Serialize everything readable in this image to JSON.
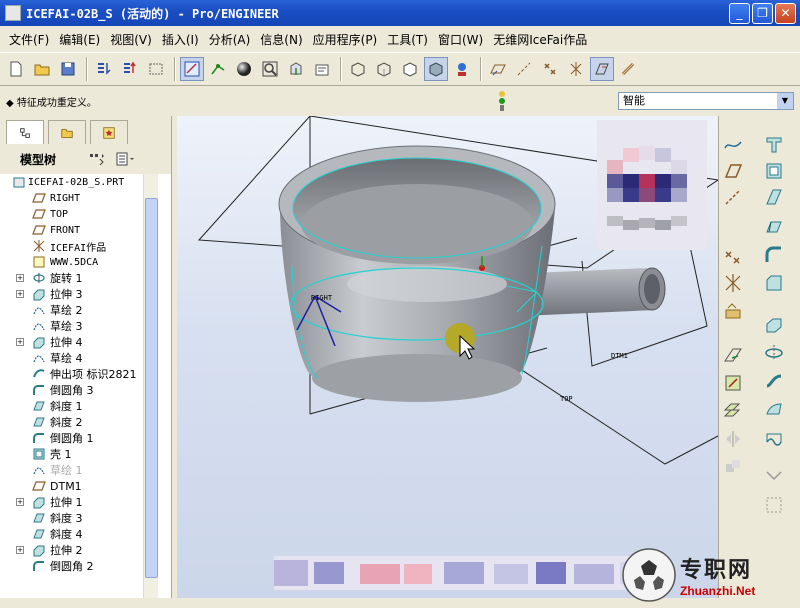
{
  "window": {
    "title": "ICEFAI-02B_S (活动的) - Pro/ENGINEER",
    "min_label": "_",
    "max_label": "❐",
    "close_label": "✕"
  },
  "menu": [
    {
      "label": "文件(F)"
    },
    {
      "label": "编辑(E)"
    },
    {
      "label": "视图(V)"
    },
    {
      "label": "插入(I)"
    },
    {
      "label": "分析(A)"
    },
    {
      "label": "信息(N)"
    },
    {
      "label": "应用程序(P)"
    },
    {
      "label": "工具(T)"
    },
    {
      "label": "窗口(W)"
    },
    {
      "label": "无维网IceFai作品"
    }
  ],
  "status": {
    "message": "◆ 特征成功重定义。",
    "filter_value": "智能"
  },
  "model_tree": {
    "header": "模型树",
    "items": [
      {
        "label": "ICEFAI-02B_S.PRT",
        "expand": "",
        "icon": "part-icon"
      },
      {
        "label": "RIGHT",
        "expand": "",
        "icon": "datum-plane-icon"
      },
      {
        "label": "TOP",
        "expand": "",
        "icon": "datum-plane-icon"
      },
      {
        "label": "FRONT",
        "expand": "",
        "icon": "datum-plane-icon"
      },
      {
        "label": "ICEFAI作品",
        "expand": "",
        "icon": "csys-icon"
      },
      {
        "label": "WWW.5DCA",
        "expand": "",
        "icon": "note-icon"
      },
      {
        "label": "旋转 1",
        "expand": "+",
        "icon": "revolve-icon"
      },
      {
        "label": "拉伸 3",
        "expand": "+",
        "icon": "extrude-icon"
      },
      {
        "label": "草绘 2",
        "expand": "",
        "icon": "sketch-icon"
      },
      {
        "label": "草绘 3",
        "expand": "",
        "icon": "sketch-icon"
      },
      {
        "label": "拉伸 4",
        "expand": "+",
        "icon": "extrude-icon"
      },
      {
        "label": "草绘 4",
        "expand": "",
        "icon": "sketch-icon"
      },
      {
        "label": "伸出项 标识2821",
        "expand": "",
        "icon": "protrusion-icon"
      },
      {
        "label": "倒圆角 3",
        "expand": "",
        "icon": "round-icon"
      },
      {
        "label": "斜度 1",
        "expand": "",
        "icon": "draft-icon"
      },
      {
        "label": "斜度 2",
        "expand": "",
        "icon": "draft-icon"
      },
      {
        "label": "倒圆角 1",
        "expand": "",
        "icon": "round-icon"
      },
      {
        "label": "壳 1",
        "expand": "",
        "icon": "shell-icon"
      },
      {
        "label": "草绘 1",
        "expand": "",
        "icon": "sketch-icon",
        "dim": true
      },
      {
        "label": "DTM1",
        "expand": "",
        "icon": "datum-plane-icon"
      },
      {
        "label": "拉伸 1",
        "expand": "+",
        "icon": "extrude-icon"
      },
      {
        "label": "斜度 3",
        "expand": "",
        "icon": "draft-icon"
      },
      {
        "label": "斜度 4",
        "expand": "",
        "icon": "draft-icon"
      },
      {
        "label": "拉伸 2",
        "expand": "+",
        "icon": "extrude-icon"
      },
      {
        "label": "倒圆角 2",
        "expand": "",
        "icon": "round-icon"
      }
    ]
  },
  "viewport": {
    "datum_labels": {
      "right": "RIGHT",
      "top": "TOP",
      "dtm1": "DTM1"
    }
  },
  "watermark": {
    "text": "专职网",
    "url": "Zhuanzhi.Net"
  },
  "colors": {
    "titlebar": "#1a4fc3",
    "part": "#a3a6ab",
    "highlight": "#22d3d3",
    "cursor_halo": "#b8a81a"
  }
}
